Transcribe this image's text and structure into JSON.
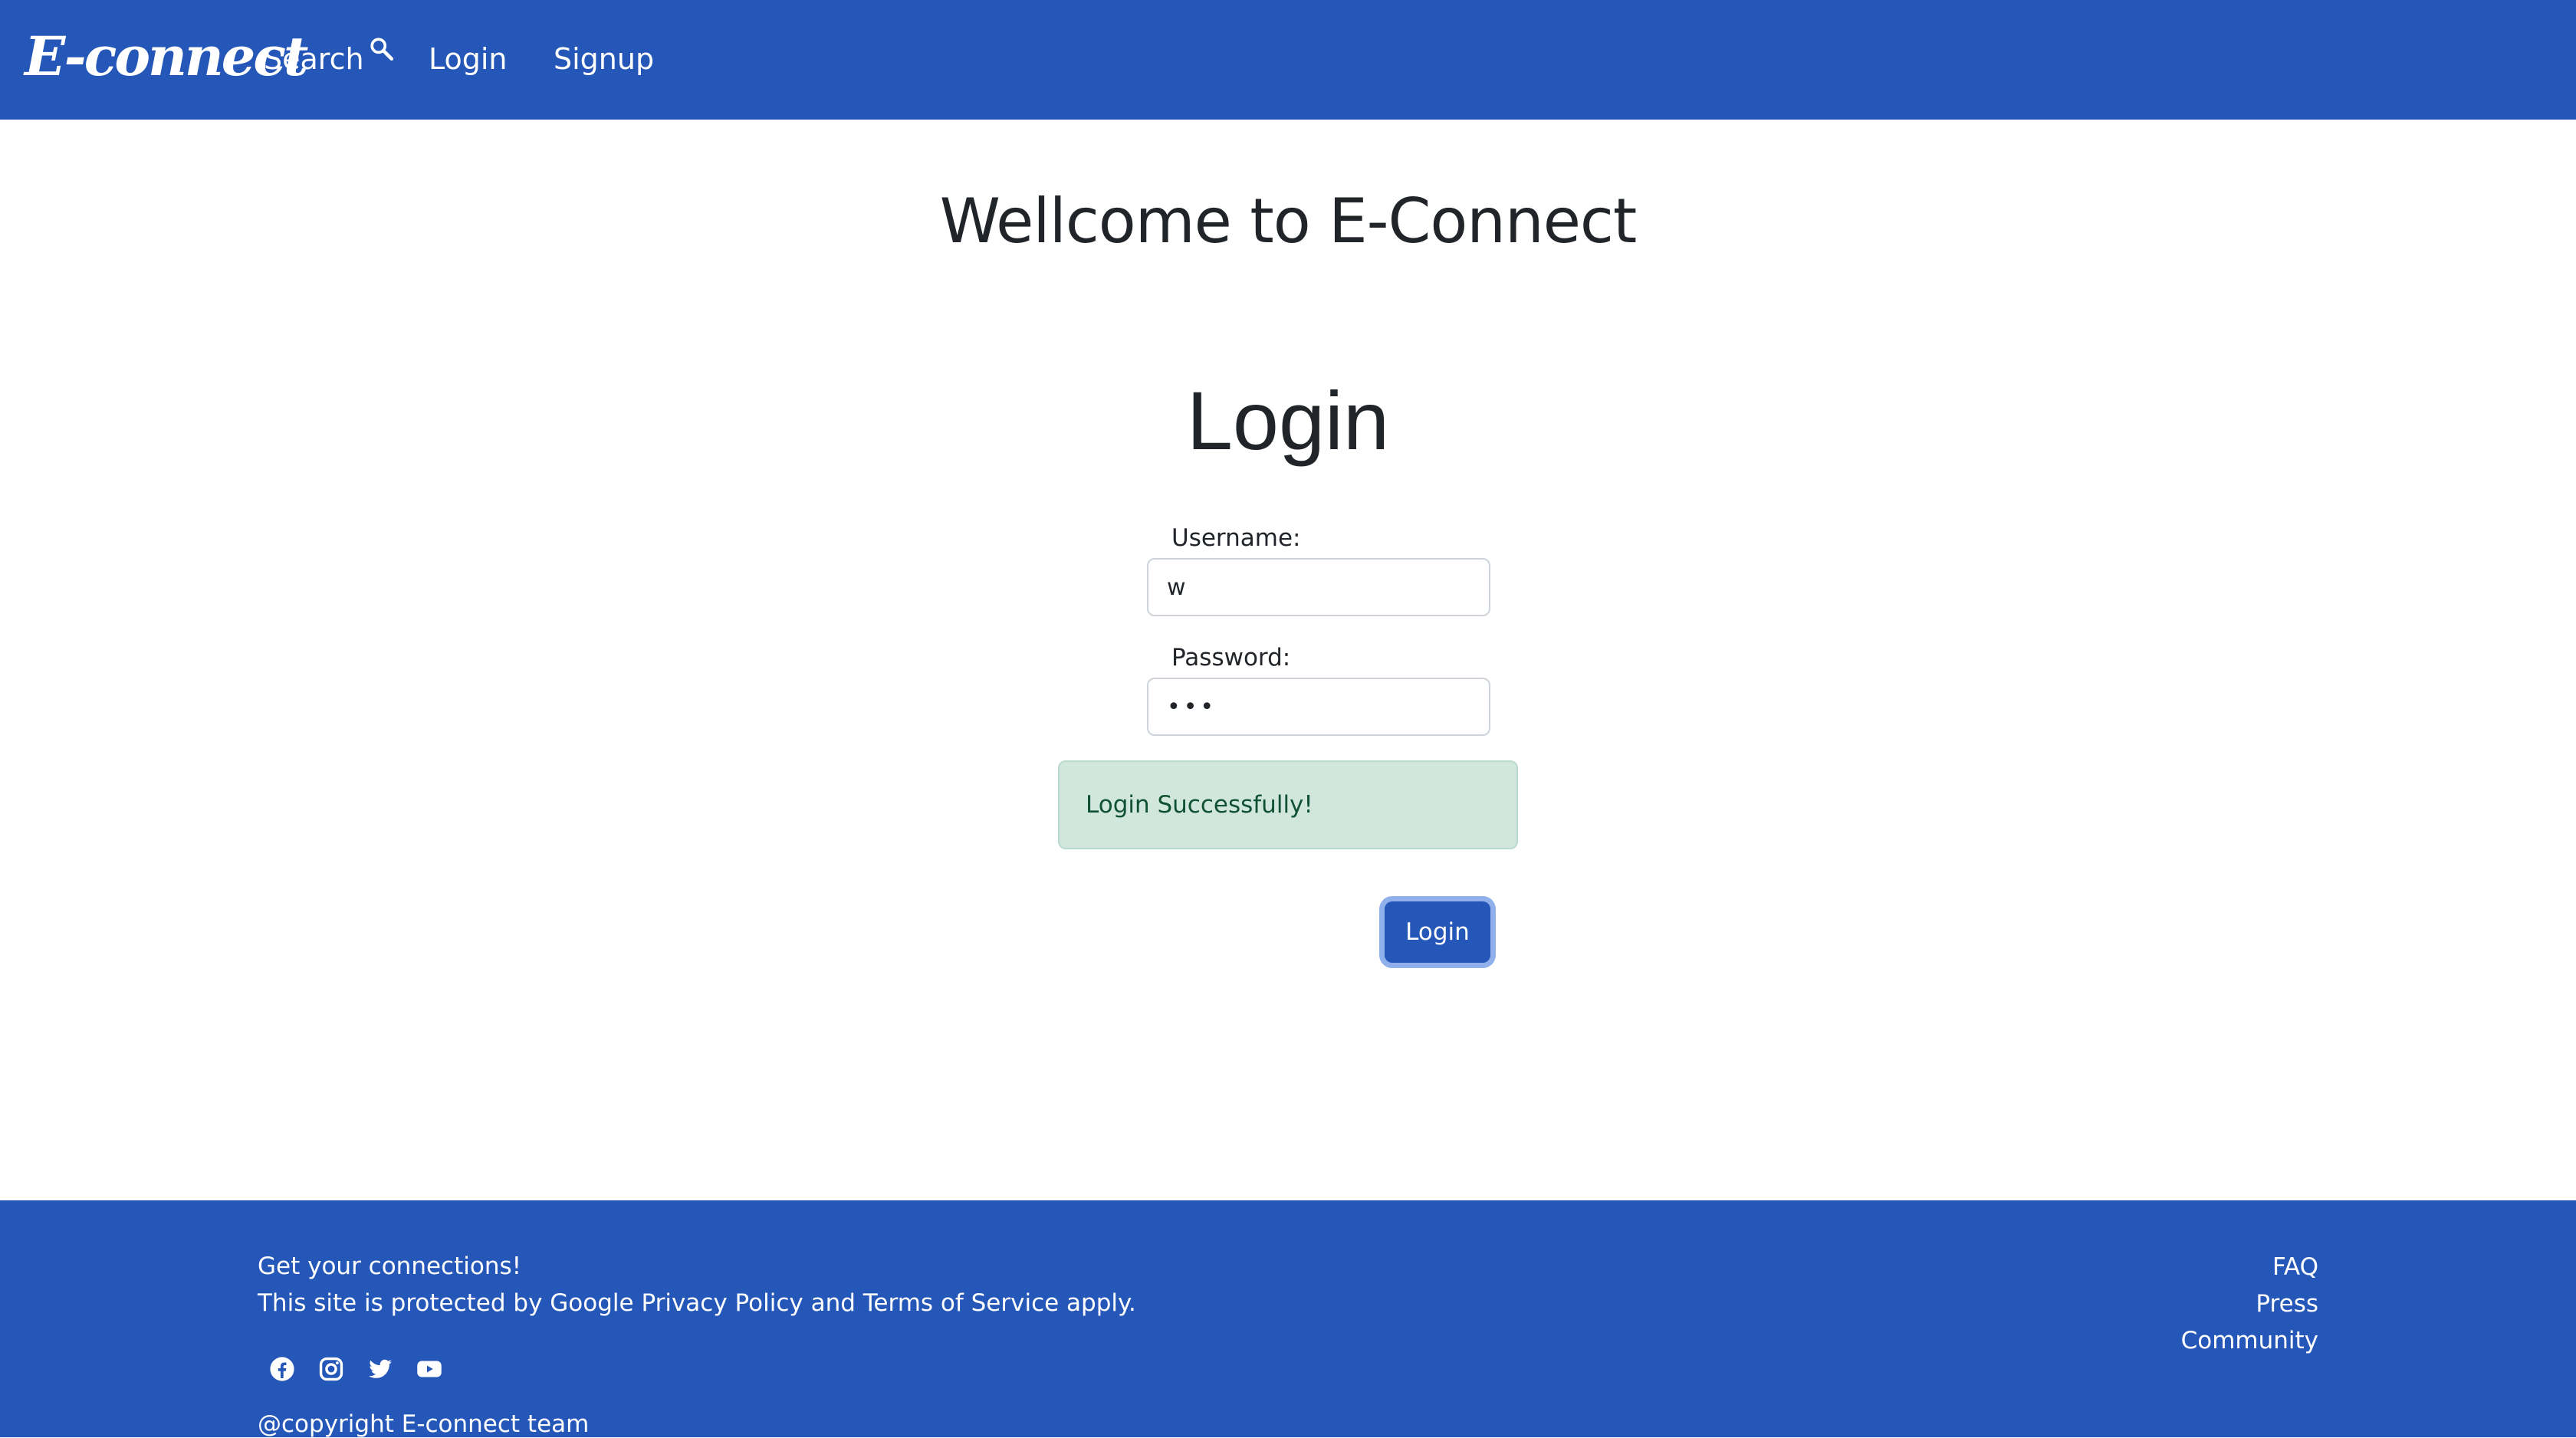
{
  "navbar": {
    "brand": "E-connect",
    "links": {
      "search": "Search",
      "login": "Login",
      "signup": "Signup"
    },
    "icons": {
      "search": "magnifier-icon"
    },
    "colors": {
      "background": "#2457b8",
      "text": "#ffffff"
    }
  },
  "main": {
    "welcome_heading": "Wellcome to E-Connect",
    "form_title": "Login",
    "username_label": "Username:",
    "username_value": "w",
    "password_label": "Password:",
    "password_value": "•••",
    "alert_message": "Login Successfully!",
    "submit_label": "Login",
    "colors": {
      "alert_background": "#d1e7dd",
      "alert_text": "#0f5132",
      "button": "#2457b8"
    }
  },
  "footer": {
    "tagline": "Get your connections!",
    "legal_prefix": "This site is protected by Google ",
    "privacy_link": "Privacy Policy",
    "legal_and": " and ",
    "terms_link": "Terms of Service",
    "legal_suffix": " apply.",
    "social_icons": [
      "facebook-icon",
      "instagram-icon",
      "twitter-icon",
      "youtube-icon"
    ],
    "copyright": "@copyright E-connect team",
    "links": {
      "faq": "FAQ",
      "press": "Press",
      "community": "Community"
    }
  }
}
